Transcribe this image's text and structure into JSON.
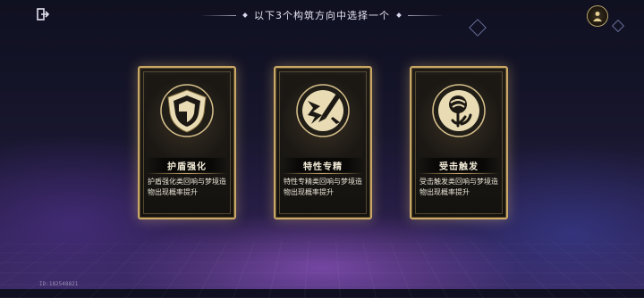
{
  "header": {
    "title": "以下3个构筑方向中选择一个",
    "back_icon": "exit-door-icon",
    "menu_icon": "character-portrait-icon"
  },
  "cards": [
    {
      "name": "护盾强化",
      "description": "护盾强化类回响与梦境造物出现概率提升",
      "icon": "shield-icon"
    },
    {
      "name": "特性专精",
      "description": "特性专精类回响与梦境造物出现概率提升",
      "icon": "sword-burst-icon"
    },
    {
      "name": "受击触发",
      "description": "受击触发类回响与梦境造物出现概率提升",
      "icon": "swirl-orb-icon"
    }
  ],
  "footer": {
    "uid": "ID:182548821"
  },
  "colors": {
    "gold": "#c9a867",
    "background": "#17162d"
  }
}
